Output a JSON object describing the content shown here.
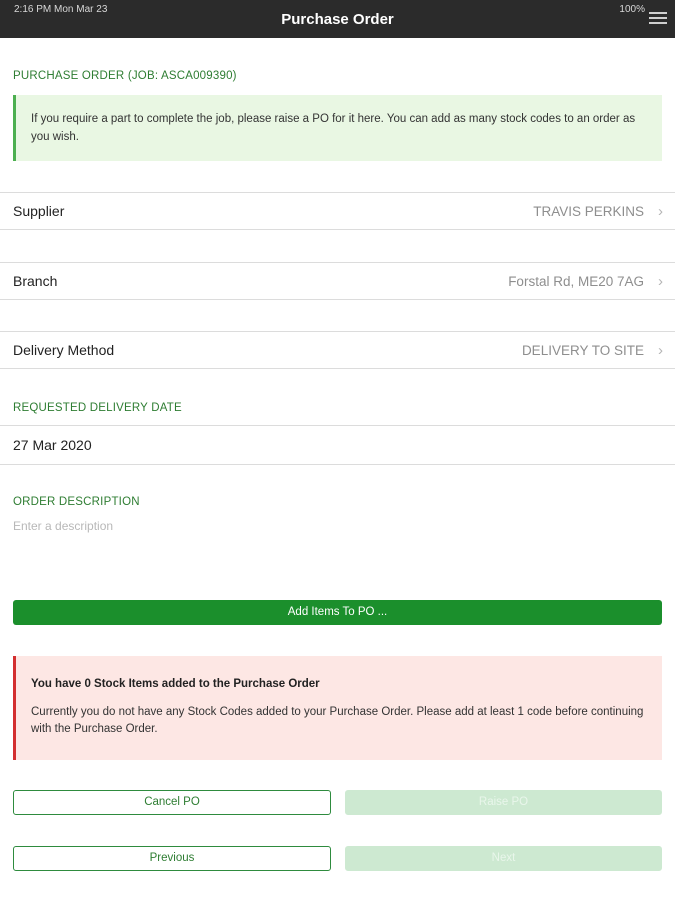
{
  "status_bar": {
    "time": "2:16 PM   Mon Mar 23",
    "battery": "100%"
  },
  "nav": {
    "title": "Purchase Order",
    "menu_icon": "hamburger-menu-icon"
  },
  "po_section": {
    "label": "PURCHASE ORDER (JOB: ASCA009390)",
    "info": "If you require a part to complete the job, please raise a PO for it here. You can add as many stock codes to an order as you wish."
  },
  "supplier": {
    "label": "Supplier",
    "value": "TRAVIS PERKINS"
  },
  "branch": {
    "label": "Branch",
    "value": "Forstal Rd, ME20 7AG"
  },
  "delivery_method": {
    "label": "Delivery Method",
    "value": "DELIVERY TO SITE"
  },
  "delivery_date": {
    "label": "REQUESTED DELIVERY DATE",
    "value": "27 Mar 2020"
  },
  "description": {
    "label": "ORDER DESCRIPTION",
    "placeholder": "Enter a description",
    "value": ""
  },
  "add_items_button": "Add Items To PO ...",
  "warning": {
    "title": "You have 0 Stock Items added to the Purchase Order",
    "text": "Currently you do not have any Stock Codes added to your Purchase Order. Please add at least 1 code before continuing with the Purchase Order."
  },
  "buttons": {
    "cancel": "Cancel PO",
    "raise": "Raise PO",
    "previous": "Previous",
    "next": "Next"
  },
  "colors": {
    "accent_green": "#1b8f2c",
    "label_green": "#2e7d32",
    "info_bg": "#e9f7e3",
    "warning_bg": "#fde7e4",
    "warning_border": "#d32f2f"
  }
}
